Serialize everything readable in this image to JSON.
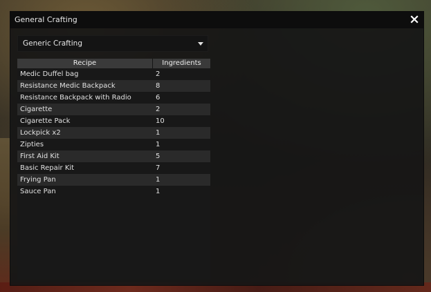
{
  "window": {
    "title": "General Crafting",
    "close_icon": "close-icon"
  },
  "category_dropdown": {
    "selected": "Generic Crafting",
    "arrow_icon": "triangle-down-icon"
  },
  "table": {
    "headers": {
      "recipe": "Recipe",
      "ingredients": "Ingredients"
    },
    "rows": [
      {
        "recipe": "Medic Duffel bag",
        "ingredients": "2"
      },
      {
        "recipe": "Resistance Medic Backpack",
        "ingredients": "8"
      },
      {
        "recipe": "Resistance Backpack with Radio",
        "ingredients": "6"
      },
      {
        "recipe": "Cigarette",
        "ingredients": "2"
      },
      {
        "recipe": "Cigarette Pack",
        "ingredients": "10"
      },
      {
        "recipe": "Lockpick x2",
        "ingredients": "1"
      },
      {
        "recipe": "Zipties",
        "ingredients": "1"
      },
      {
        "recipe": "First Aid Kit",
        "ingredients": "5"
      },
      {
        "recipe": "Basic Repair Kit",
        "ingredients": "7"
      },
      {
        "recipe": "Frying Pan",
        "ingredients": "1"
      },
      {
        "recipe": "Sauce Pan",
        "ingredients": "1"
      }
    ]
  },
  "colors": {
    "window_bg": "#161616",
    "titlebar_bg": "#0d0d0d",
    "header_bg": "#3a3a3a",
    "row_alt_bg": "#2a2a2a",
    "text": "#e2e2e2"
  }
}
